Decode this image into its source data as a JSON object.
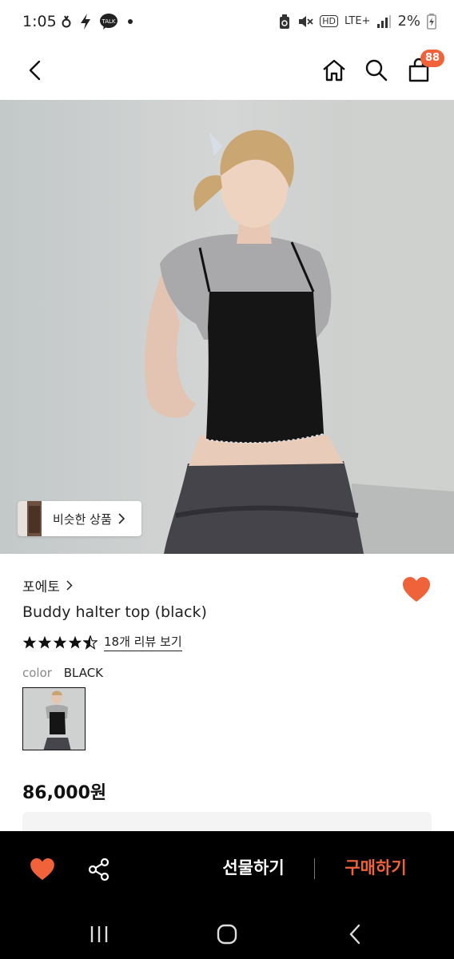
{
  "status_bar": {
    "time": "1:05",
    "battery": "2%",
    "network": "LTE+",
    "hd": "HD",
    "talk_icon_label": "TALK",
    "icons": [
      "notification-icon",
      "flash-icon",
      "kakaotalk-icon",
      "dot-icon",
      "recycle-icon",
      "mute-icon",
      "signal-icon",
      "battery-icon"
    ]
  },
  "header": {
    "cart_count": "88",
    "icons": [
      "back-arrow-icon",
      "home-icon",
      "search-icon",
      "cart-icon"
    ]
  },
  "hero": {
    "similar_button_label": "비슷한 상품"
  },
  "product": {
    "brand": "포에토",
    "name": "Buddy halter top (black)",
    "rating": 4.5,
    "rating_max": 5,
    "review_link": "18개 리뷰 보기",
    "color_label": "color",
    "color_value": "BLACK",
    "price": "86,000원"
  },
  "bottom_bar": {
    "gift_label": "선물하기",
    "buy_label": "구매하기"
  },
  "colors": {
    "accent": "#f0623a",
    "bar_background": "#000000"
  }
}
